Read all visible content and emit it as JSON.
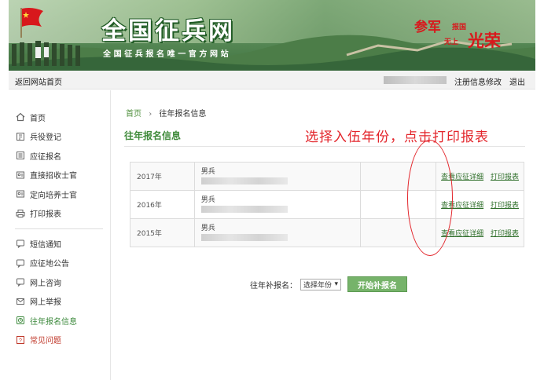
{
  "banner": {
    "title": "全国征兵网",
    "subtitle": "全国征兵报名唯一官方网站",
    "slogan_1": "参军",
    "slogan_2": "报国",
    "slogan_3": "无上",
    "slogan_4": "光荣"
  },
  "topbar": {
    "back_label": "返回网站首页",
    "edit_label": "注册信息修改",
    "logout_label": "退出"
  },
  "sidebar": {
    "group1": [
      {
        "label": "首页",
        "icon": "home-icon"
      },
      {
        "label": "兵役登记",
        "icon": "register-icon"
      },
      {
        "label": "应征报名",
        "icon": "form-icon"
      },
      {
        "label": "直接招收士官",
        "icon": "recruit-icon"
      },
      {
        "label": "定向培养士官",
        "icon": "training-icon"
      },
      {
        "label": "打印报表",
        "icon": "printer-icon"
      }
    ],
    "group2": [
      {
        "label": "短信通知",
        "icon": "message-icon"
      },
      {
        "label": "应征地公告",
        "icon": "notice-icon"
      },
      {
        "label": "网上咨询",
        "icon": "consult-icon"
      },
      {
        "label": "网上举报",
        "icon": "report-icon"
      },
      {
        "label": "往年报名信息",
        "icon": "history-icon"
      },
      {
        "label": "常见问题",
        "icon": "question-icon"
      }
    ]
  },
  "breadcrumb": {
    "home": "首页",
    "current": "往年报名信息"
  },
  "section_title": "往年报名信息",
  "annotation": "选择入伍年份，点击打印报表",
  "records": [
    {
      "year": "2017年",
      "type": "男兵",
      "view_label": "查看应征详细",
      "print_label": "打印报表"
    },
    {
      "year": "2016年",
      "type": "男兵",
      "view_label": "查看应征详细",
      "print_label": "打印报表"
    },
    {
      "year": "2015年",
      "type": "男兵",
      "view_label": "查看应征详细",
      "print_label": "打印报表"
    }
  ],
  "supplement": {
    "label": "往年补报名：",
    "select_value": "选择年份",
    "button_label": "开始补报名"
  },
  "colors": {
    "accent_green": "#3f8a3a",
    "annotation_red": "#e3262c",
    "button_green": "#76b36a"
  }
}
